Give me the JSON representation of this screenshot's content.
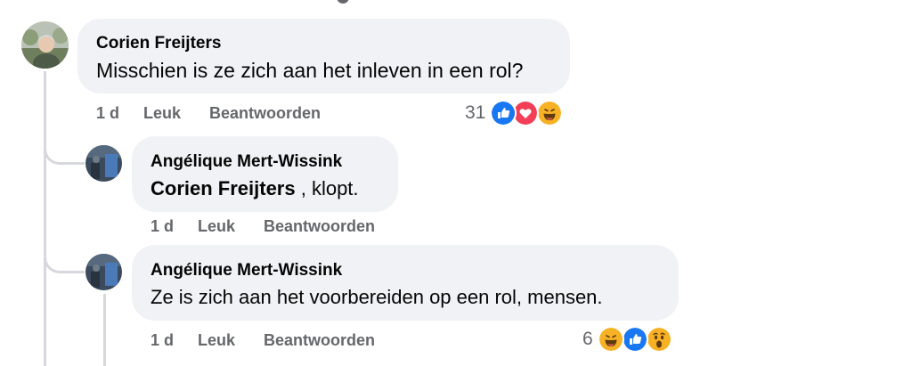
{
  "comments": [
    {
      "author": "Corien Freijters",
      "text": "Misschien is ze zich aan het inleven in een rol?",
      "time": "1 d",
      "like_label": "Leuk",
      "reply_label": "Beantwoorden",
      "reaction_count": "31",
      "reactions": [
        "like-icon",
        "love-icon",
        "haha-icon"
      ]
    },
    {
      "author": "Angélique Mert-Wissink",
      "mention": "Corien Freijters",
      "text": " , klopt.",
      "time": "1 d",
      "like_label": "Leuk",
      "reply_label": "Beantwoorden"
    },
    {
      "author": "Angélique Mert-Wissink",
      "text": "Ze is zich aan het voorbereiden op een rol, mensen.",
      "time": "1 d",
      "like_label": "Leuk",
      "reply_label": "Beantwoorden",
      "reaction_count": "6",
      "reactions": [
        "haha-icon",
        "like-icon",
        "wow-icon"
      ]
    }
  ],
  "colors": {
    "bubble": "#f0f2f5",
    "meta": "#65676b",
    "like": "#1877f2",
    "love": "#f33e58",
    "emoji": "#f7b125"
  }
}
